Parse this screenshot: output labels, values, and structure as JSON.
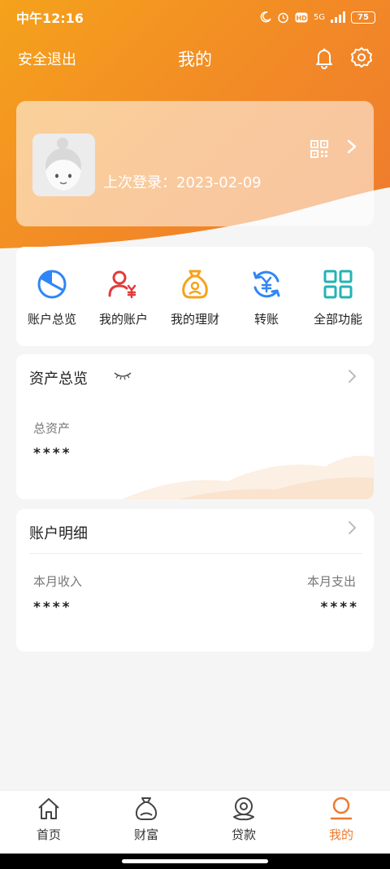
{
  "status_bar": {
    "time": "中午12:16",
    "network": "5G",
    "battery": "75"
  },
  "nav": {
    "logout": "安全退出",
    "title": "我的"
  },
  "profile": {
    "last_login_label": "上次登录：",
    "last_login_date": "2023-02-09"
  },
  "quick_actions": [
    {
      "label": "账户总览",
      "icon": "pie-chart-icon",
      "color": "#2f86f6"
    },
    {
      "label": "我的账户",
      "icon": "user-yuan-icon",
      "color": "#e23b3b"
    },
    {
      "label": "我的理财",
      "icon": "money-bag-icon",
      "color": "#f5a21c"
    },
    {
      "label": "转账",
      "icon": "transfer-yuan-icon",
      "color": "#2f86f6"
    },
    {
      "label": "全部功能",
      "icon": "grid-icon",
      "color": "#25b3b3"
    }
  ],
  "assets": {
    "title": "资产总览",
    "total_label": "总资产",
    "total_value": "****"
  },
  "details": {
    "title": "账户明细",
    "income_label": "本月收入",
    "income_value": "****",
    "expense_label": "本月支出",
    "expense_value": "****"
  },
  "tabs": [
    {
      "label": "首页",
      "icon": "home-icon"
    },
    {
      "label": "财富",
      "icon": "wealth-bag-icon"
    },
    {
      "label": "贷款",
      "icon": "loan-icon"
    },
    {
      "label": "我的",
      "icon": "profile-icon",
      "active": true
    }
  ],
  "colors": {
    "accent": "#ee7a2e",
    "header_start": "#f5a21c"
  }
}
